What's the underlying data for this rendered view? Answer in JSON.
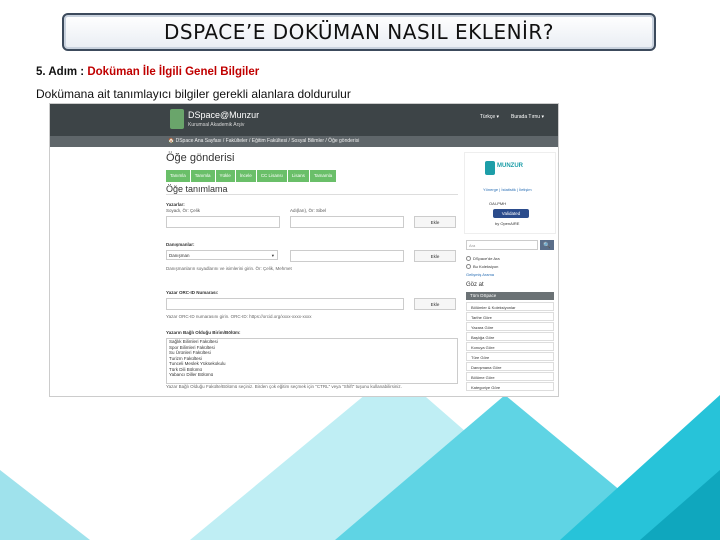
{
  "slide": {
    "title": "DSPACE’E DOKÜMAN NASIL EKLENİR?",
    "step_number": "5. Adım :",
    "step_text": "Doküman İle İlgili Genel Bilgiler",
    "description": "Dokümana ait tanımlayıcı bilgiler gerekli alanlara doldurulur"
  },
  "colors": {
    "accent_red": "#c00000",
    "cyan": "#27c3d9",
    "green_tab": "#6abf69",
    "topbar": "#3d4447"
  },
  "screenshot": {
    "site_name": "DSpace@Munzur",
    "site_subtitle": "Kurumsal Akademik Arşiv",
    "top_links": [
      "Türkçe ▾",
      "Burada Tırnu ▾"
    ],
    "breadcrumb": "🏠 DSpace Ana Sayfası / Fakülteler / Eğitim Fakültesi / Sosyal Bilimler / Öğe gönderisi",
    "page_title": "Öğe gönderisi",
    "tabs": [
      "Tanımla",
      "Tanımla",
      "Yükle",
      "İncele",
      "CC Lisansı",
      "Lisans",
      "Tamamla"
    ],
    "section_title": "Öğe tanımlama",
    "fields": {
      "author_label": "Yazarlar:",
      "surname_sub": "Soyadı, Ör: Çelik",
      "given_sub": "Adı(ları), Ör: Sibel",
      "add_label": "Ekle",
      "advisor_label": "Danışmanlar:",
      "advisor_value": "Danışman",
      "advisor_hint": "Danışmanların soyadlarını ve isimlerini girin. Ör: Çelik, Mehmet",
      "orcid_label": "Yazar ORC-ID Numarası:",
      "orcid_hint": "Yazar ORC-ID numarasını girin. ORC-ID: https://orcid.org/xxxx-xxxx-xxxx",
      "dept_label": "Yazarın Bağlı Olduğu Birim/Bölüm:",
      "dept_hint": "Yazar Bağlı Olduğu Fakülte/Bölümü seçiniz. Birden çok eğitim seçmek için \"CTRL\" veya \"Shift\" tuşunu kullanabilirsiniz."
    },
    "dept_list": [
      "Sağlık Bilimleri Fakültesi",
      "Spor Bilimleri Fakültesi",
      "Su Ürünleri Fakültesi",
      "Turizm Fakültesi",
      "Tunceli Meslek Yüksekokulu",
      "Türk Dili Bölümü",
      "Yabancı Diller Bölümü"
    ],
    "sidebar": {
      "logo_text": "MUNZUR",
      "links": "Yönerge | İstatistik | İletişim",
      "oai": "OAI-PMH",
      "badge": "Validated",
      "by": "by OpenAIRE",
      "search_placeholder": "Ara",
      "search_button": "🔍",
      "radio_1": "DSpace'de Ara",
      "radio_2": "Bu Koleksiyon",
      "advanced": "Gelişmiş Arama",
      "browse_heading": "Göz at",
      "browse_active": "Tüm DSpace",
      "browse_items": [
        "Bölümler & Koleksiyonlar",
        "Tarihe Göre",
        "Yazara Göre",
        "Başlığa Göre",
        "Konuya Göre",
        "Türe Göre",
        "Danışmana Göre",
        "Bölüme Göre",
        "Kategoriye Göre"
      ]
    }
  }
}
